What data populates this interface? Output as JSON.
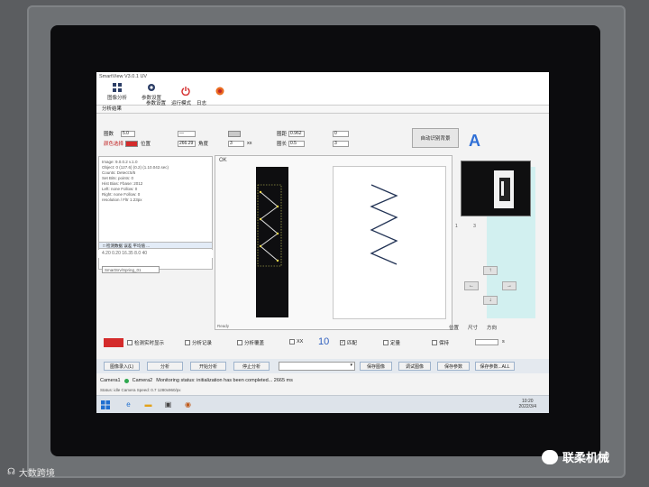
{
  "app": {
    "title": "SmartView  V3.0.1  UV",
    "toolbar": [
      {
        "label": "图像分析",
        "icon": "grid-icon"
      },
      {
        "label": "参数设置",
        "icon": "gear-icon"
      },
      {
        "label": "",
        "icon": "power-icon"
      },
      {
        "label": "",
        "icon": "record-icon"
      }
    ],
    "tab_labels": [
      "参数设置",
      "运行模式",
      "日志"
    ],
    "section_tab": "分析结果"
  },
  "params": {
    "count_label": "圈数",
    "count_value": "5.0",
    "color_label": "颜色选择",
    "pos_label": "位置",
    "field1": "—",
    "field2": "266.29",
    "field3_label": "角度",
    "field4": "3",
    "field5": "xx",
    "right1_label": "圈距",
    "right1_value": "0.962",
    "right2_label": "圈长",
    "right2_value": "0.5",
    "right3_value": "0",
    "right4_value": "3",
    "adjust_button": "自动识别背景",
    "mode_letter": "A"
  },
  "log": {
    "lines": [
      "Image: 9.0.0.2 v.1.0",
      "Object: 0 (127.6) (0.2) (1.10.042.sec)",
      "",
      "Counts: Detect:5/5",
      "Set Bits: points: 0",
      "Hist Bias: Fbase: 2012",
      "",
      "Left: none Follow: 0",
      "Right: none Follow: 0",
      "",
      "resolution / Fltr 1.23px"
    ],
    "tabs": "□ 检测数据  误差  平均值  ...",
    "values": "4.20  0.20  16.35  8.0  40",
    "path_field": "SmartSrv/Spring_01"
  },
  "image_view": {
    "status": "OK",
    "footer": "Ready"
  },
  "preview_nums": [
    "1",
    "3"
  ],
  "dpad": [
    "↑",
    "←",
    "→",
    "↓"
  ],
  "rv_labels": [
    "位置",
    "尺寸",
    "方向"
  ],
  "checks": [
    {
      "label": "检测实时显示",
      "checked": false
    },
    {
      "label": "分析记录",
      "checked": false
    },
    {
      "label": "分析覆盖",
      "checked": false
    },
    {
      "label": "XX",
      "checked": false
    },
    {
      "label": "匹配",
      "checked": true
    },
    {
      "label": "定量",
      "checked": false
    },
    {
      "label": "保持",
      "checked": false
    }
  ],
  "big_number": "10",
  "unit_label": "s",
  "actions": [
    "图像录入(L)",
    "分析",
    "开始分析",
    "停止分析",
    "保存图像",
    "调试图像",
    "保存参数",
    "保存参数...ALL"
  ],
  "combo_value": "",
  "status": {
    "camera1": "Camera1",
    "camera2": "Camera2",
    "message": "Monitoring status: initialization has been completed... 2665 ms",
    "line2": "Status: idle  Camera Speed: 0.7    1280x960/px"
  },
  "taskbar": {
    "time": "10:20",
    "date": "2022/3/4"
  },
  "watermarks": {
    "left": "大数跨境",
    "right": "联柔机械"
  }
}
